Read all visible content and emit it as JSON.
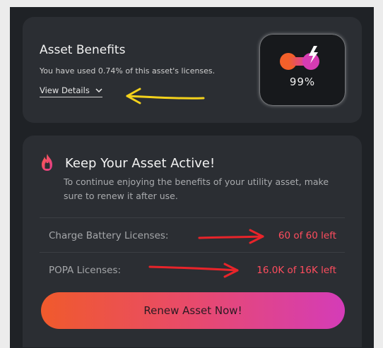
{
  "benefits": {
    "title": "Asset Benefits",
    "usage_text": "You have used 0.74% of this asset's licenses.",
    "view_details_label": "View Details",
    "percent": "99%",
    "gauge_icon": "battery-charge-icon"
  },
  "active": {
    "title": "Keep Your Asset Active!",
    "description": "To continue enjoying the benefits of your utility asset, make sure to renew it after use.",
    "icon": "fire-icon",
    "rows": [
      {
        "label": "Charge Battery Licenses:",
        "value": "60 of 60 left"
      },
      {
        "label": "POPA Licenses:",
        "value": "16.0K of 16K left"
      }
    ],
    "cta_label": "Renew Asset Now!"
  },
  "colors": {
    "accent_value": "#ff4d5e",
    "gradient_start": "#f05a2c",
    "gradient_end": "#d43cb8",
    "annotation_yellow": "#f4d21c",
    "annotation_red": "#e8242a"
  }
}
